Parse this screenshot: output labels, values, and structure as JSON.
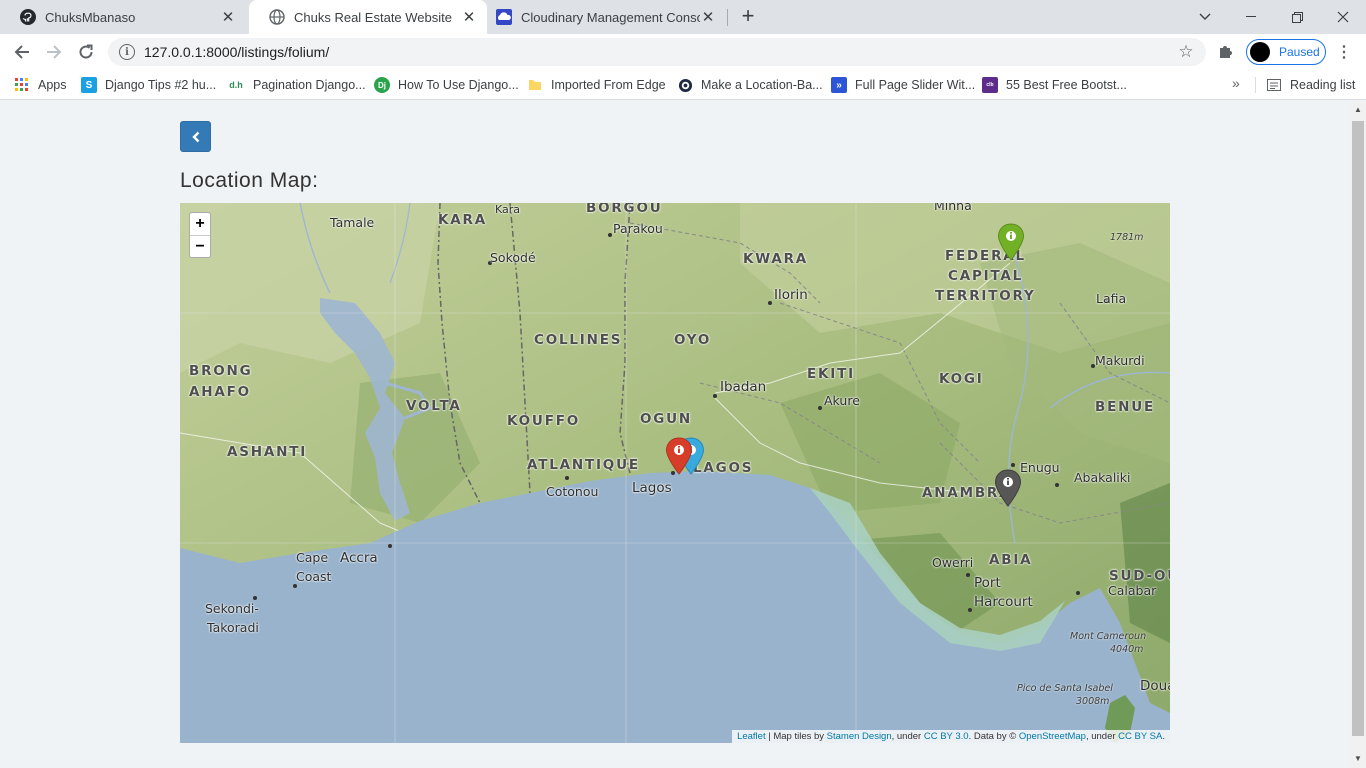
{
  "browser": {
    "tabs": [
      {
        "title": "ChuksMbanaso",
        "icon": "github-icon"
      },
      {
        "title": "Chuks Real Estate Website",
        "icon": "globe-icon"
      },
      {
        "title": "Cloudinary Management Console",
        "icon": "cloudinary-icon"
      }
    ],
    "url": "127.0.0.1:8000/listings/folium/",
    "profile_label": "Paused",
    "bookmarks": [
      {
        "label": "Apps",
        "icon": "apps-grid-icon"
      },
      {
        "label": "Django Tips #2 hu...",
        "icon": "s-icon"
      },
      {
        "label": "Pagination Django...",
        "icon": "dh-icon"
      },
      {
        "label": "How To Use Django...",
        "icon": "dj-icon"
      },
      {
        "label": "Imported From Edge",
        "icon": "folder-icon"
      },
      {
        "label": "Make a Location-Ba...",
        "icon": "globe-icon"
      },
      {
        "label": "Full Page Slider Wit...",
        "icon": "bookmark-icon"
      },
      {
        "label": "55 Best Free Bootst...",
        "icon": "colorlib-icon"
      }
    ],
    "bookmarks_overflow": "»",
    "reading_list": "Reading list"
  },
  "page": {
    "title": "Location Map:"
  },
  "map": {
    "zoom_in": "+",
    "zoom_out": "−",
    "labels": {
      "regions": [
        "KARA",
        "BORGOU",
        "KWARA",
        "FEDERAL",
        "CAPITAL",
        "TERRITORY",
        "COLLINES",
        "OYO",
        "BRONG",
        "AHAFO",
        "EKITI",
        "KOGI",
        "VOLTA",
        "KOUFFO",
        "OGUN",
        "BENUE",
        "ASHANTI",
        "ATLANTIQUE",
        "LAGOS",
        "ANAMBRA",
        "ABIA",
        "SUD-OU"
      ],
      "cities": [
        "Tamale",
        "Kara",
        "Parakou",
        "Minna",
        "Sokodé",
        "Ilorin",
        "Lafia",
        "Makurdi",
        "Ibadan",
        "Akure",
        "Enugu",
        "Abakaliki",
        "Cotonou",
        "Lagos",
        "Accra",
        "Cape",
        "Coast",
        "Owerri",
        "Port",
        "Harcourt",
        "Calabar",
        "Sekondi-",
        "Takoradi",
        "Doua"
      ],
      "peaks": [
        "1781m",
        "Mont Cameroun",
        "4040m",
        "Pico de Santa Isabel",
        "3008m"
      ]
    },
    "markers": [
      {
        "color": "#72b026",
        "icon": "info-sign-icon"
      },
      {
        "color": "#38aadd",
        "icon": "info-sign-icon"
      },
      {
        "color": "#d63e2a",
        "icon": "info-sign-icon"
      },
      {
        "color": "#575757",
        "icon": "info-sign-icon"
      }
    ],
    "attribution": {
      "leaflet": "Leaflet",
      "sep1": " | Map tiles by ",
      "stamen": "Stamen Design",
      "sep2": ", under ",
      "cc_by": "CC BY 3.0",
      "sep3": ". Data by © ",
      "osm": "OpenStreetMap",
      "sep4": ", under ",
      "cc_by_sa": "CC BY SA",
      "end": "."
    }
  }
}
